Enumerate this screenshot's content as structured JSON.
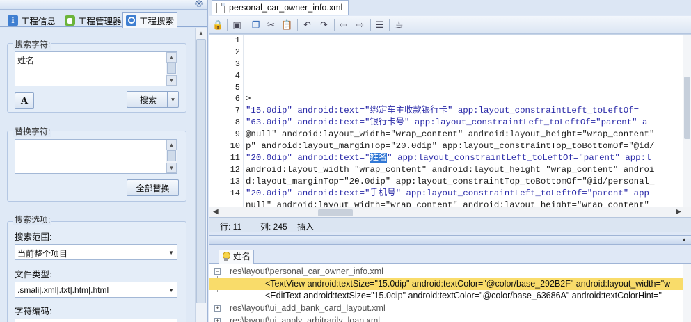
{
  "left_panel": {
    "tabs": [
      {
        "label": "工程信息"
      },
      {
        "label": "工程管理器"
      },
      {
        "label": "工程搜索"
      }
    ],
    "search_group": {
      "label": "搜索字符:",
      "value": "姓名",
      "search_button": "搜索"
    },
    "replace_group": {
      "label": "替换字符:",
      "value": "",
      "replace_all_button": "全部替换"
    },
    "options_group": {
      "label": "搜索选项:",
      "scope_label": "搜索范围:",
      "scope_value": "当前整个项目",
      "filetype_label": "文件类型:",
      "filetype_value": ".smali|.xml|.txt|.htm|.html",
      "encoding_label": "字符编码:"
    }
  },
  "editor": {
    "file_tab": "personal_car_owner_info.xml",
    "line_numbers": [
      "1",
      "2",
      "3",
      "4",
      "5",
      "6",
      "7",
      "8",
      "9",
      "10",
      "11",
      "12",
      "13",
      "14"
    ],
    "code_lines": [
      "",
      "",
      "",
      "",
      "",
      ">",
      "\"15.0dip\" android:text=\"绑定车主收款银行卡\" app:layout_constraintLeft_toLeftOf=",
      "\"63.0dip\" android:text=\"银行卡号\" app:layout_constraintLeft_toLeftOf=\"parent\" a",
      "@null\" android:layout_width=\"wrap_content\" android:layout_height=\"wrap_content\" ",
      "p\" android:layout_marginTop=\"20.0dip\" app:layout_constraintTop_toBottomOf=\"@id/",
      "",
      "android:layout_width=\"wrap_content\" android:layout_height=\"wrap_content\" androi",
      "d:layout_marginTop=\"20.0dip\" app:layout_constraintTop_toBottomOf=\"@id/personal_",
      "\"20.0dip\" android:text=\"手机号\" app:layout_constraintLeft_toLeftOf=\"parent\" app"
    ],
    "line11_before": "\"20.0dip\" android:text=\"",
    "line11_match": "姓名",
    "line11_after": "\" app:layout_constraintLeft_toLeftOf=\"parent\" app:l",
    "line15_partial": "null\" android:layout_width=\"wrap_content\" android:layout_height=\"wrap_content\" "
  },
  "status": {
    "row": "行: 11",
    "col": "列: 245",
    "mode": "插入"
  },
  "results": {
    "tab_label": "姓名",
    "rows": [
      {
        "type": "file",
        "text": "res\\layout\\personal_car_owner_info.xml",
        "expanded": true
      },
      {
        "type": "match",
        "text": "<TextView android:textSize=\"15.0dip\" android:textColor=\"@color/base_292B2F\" android:layout_width=\"w",
        "selected": true
      },
      {
        "type": "match",
        "text": "<EditText android:textSize=\"15.0dip\" android:textColor=\"@color/base_63686A\" android:textColorHint=\"",
        "selected": false
      },
      {
        "type": "file",
        "text": "res\\layout\\ui_add_bank_card_layout.xml",
        "expanded": false
      },
      {
        "type": "file",
        "text": "res\\layout\\ui_apply_arbitrarily_loan.xml",
        "expanded": false
      }
    ]
  },
  "colors": {
    "panel_bg": "#dfe8f6",
    "selection_yellow": "#f9dc6a",
    "match_highlight": "#3178d6"
  }
}
